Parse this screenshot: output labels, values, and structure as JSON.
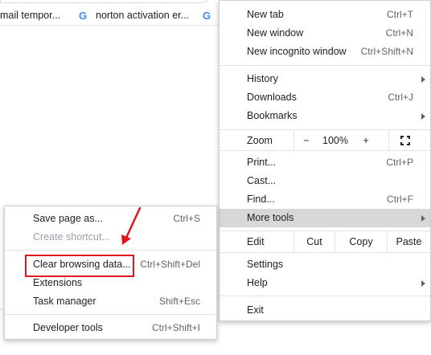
{
  "bookmarks": [
    {
      "label": "mail tempor...",
      "icon": "google-g-icon"
    },
    {
      "label": "norton activation er...",
      "icon": "google-g-icon"
    },
    {
      "label": "",
      "icon": "google-g-icon"
    }
  ],
  "menu": {
    "new_tab": {
      "label": "New tab",
      "shortcut": "Ctrl+T"
    },
    "new_window": {
      "label": "New window",
      "shortcut": "Ctrl+N"
    },
    "new_incognito": {
      "label": "New incognito window",
      "shortcut": "Ctrl+Shift+N"
    },
    "history": {
      "label": "History"
    },
    "downloads": {
      "label": "Downloads",
      "shortcut": "Ctrl+J"
    },
    "bookmarks": {
      "label": "Bookmarks"
    },
    "zoom": {
      "label": "Zoom",
      "minus": "−",
      "value": "100%",
      "plus": "+"
    },
    "print": {
      "label": "Print...",
      "shortcut": "Ctrl+P"
    },
    "cast": {
      "label": "Cast..."
    },
    "find": {
      "label": "Find...",
      "shortcut": "Ctrl+F"
    },
    "more_tools": {
      "label": "More tools"
    },
    "edit": {
      "label": "Edit",
      "cut": "Cut",
      "copy": "Copy",
      "paste": "Paste"
    },
    "settings": {
      "label": "Settings"
    },
    "help": {
      "label": "Help"
    },
    "exit": {
      "label": "Exit"
    }
  },
  "submenu": {
    "save_page": {
      "label": "Save page as...",
      "shortcut": "Ctrl+S"
    },
    "create_shortcut": {
      "label": "Create shortcut..."
    },
    "clear_browsing": {
      "label": "Clear browsing data...",
      "shortcut": "Ctrl+Shift+Del"
    },
    "extensions": {
      "label": "Extensions"
    },
    "task_manager": {
      "label": "Task manager",
      "shortcut": "Shift+Esc"
    },
    "developer_tools": {
      "label": "Developer tools",
      "shortcut": "Ctrl+Shift+I"
    }
  },
  "colors": {
    "highlight": "#e0161d",
    "active_row": "#d7d7d7",
    "google_blue": "#4285f4"
  }
}
